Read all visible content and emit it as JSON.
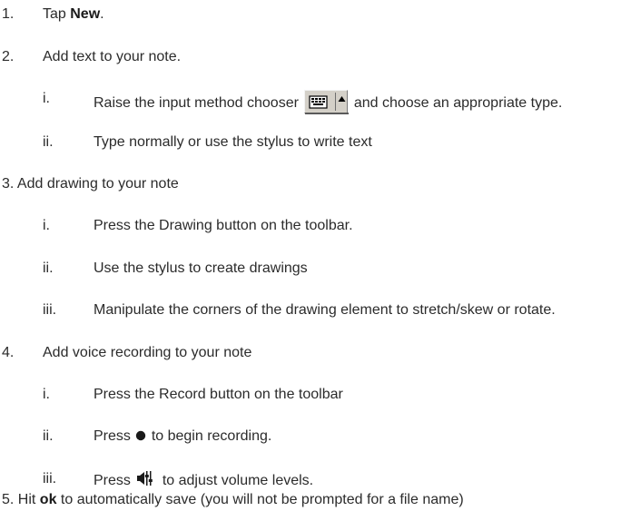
{
  "steps": {
    "s1": {
      "num": "1.",
      "pre": "Tap ",
      "bold": "New",
      "post": "."
    },
    "s2": {
      "num": "2.",
      "text": "Add text to your note."
    },
    "s2_i": {
      "num": "i.",
      "pre": "Raise the input method chooser",
      "post": "and choose an appropriate type."
    },
    "s2_ii": {
      "num": "ii.",
      "text": "Type normally or use the stylus to write text"
    },
    "s3": {
      "text": "3. Add drawing to your note"
    },
    "s3_i": {
      "num": "i.",
      "text": "Press the Drawing button on the toolbar."
    },
    "s3_ii": {
      "num": "ii.",
      "text": "Use the stylus to create drawings"
    },
    "s3_iii": {
      "num": "iii.",
      "text": "Manipulate the corners of the drawing element to stretch/skew or rotate."
    },
    "s4": {
      "num": "4.",
      "text": "Add voice recording to your note"
    },
    "s4_i": {
      "num": "i.",
      "text": "Press the Record button on the toolbar"
    },
    "s4_ii": {
      "num": "ii.",
      "pre": "Press",
      "post": "to begin recording."
    },
    "s4_iii": {
      "num": "iii.",
      "pre": "Press",
      "post": "to adjust volume levels."
    },
    "s5": {
      "pre": "5. Hit ",
      "bold": "ok",
      "post": " to automatically save (you will not be prompted for a file name)"
    }
  },
  "icons": {
    "input_chooser": "keyboard-input-chooser-icon",
    "record": "record-dot-icon",
    "volume": "volume-adjust-icon"
  }
}
